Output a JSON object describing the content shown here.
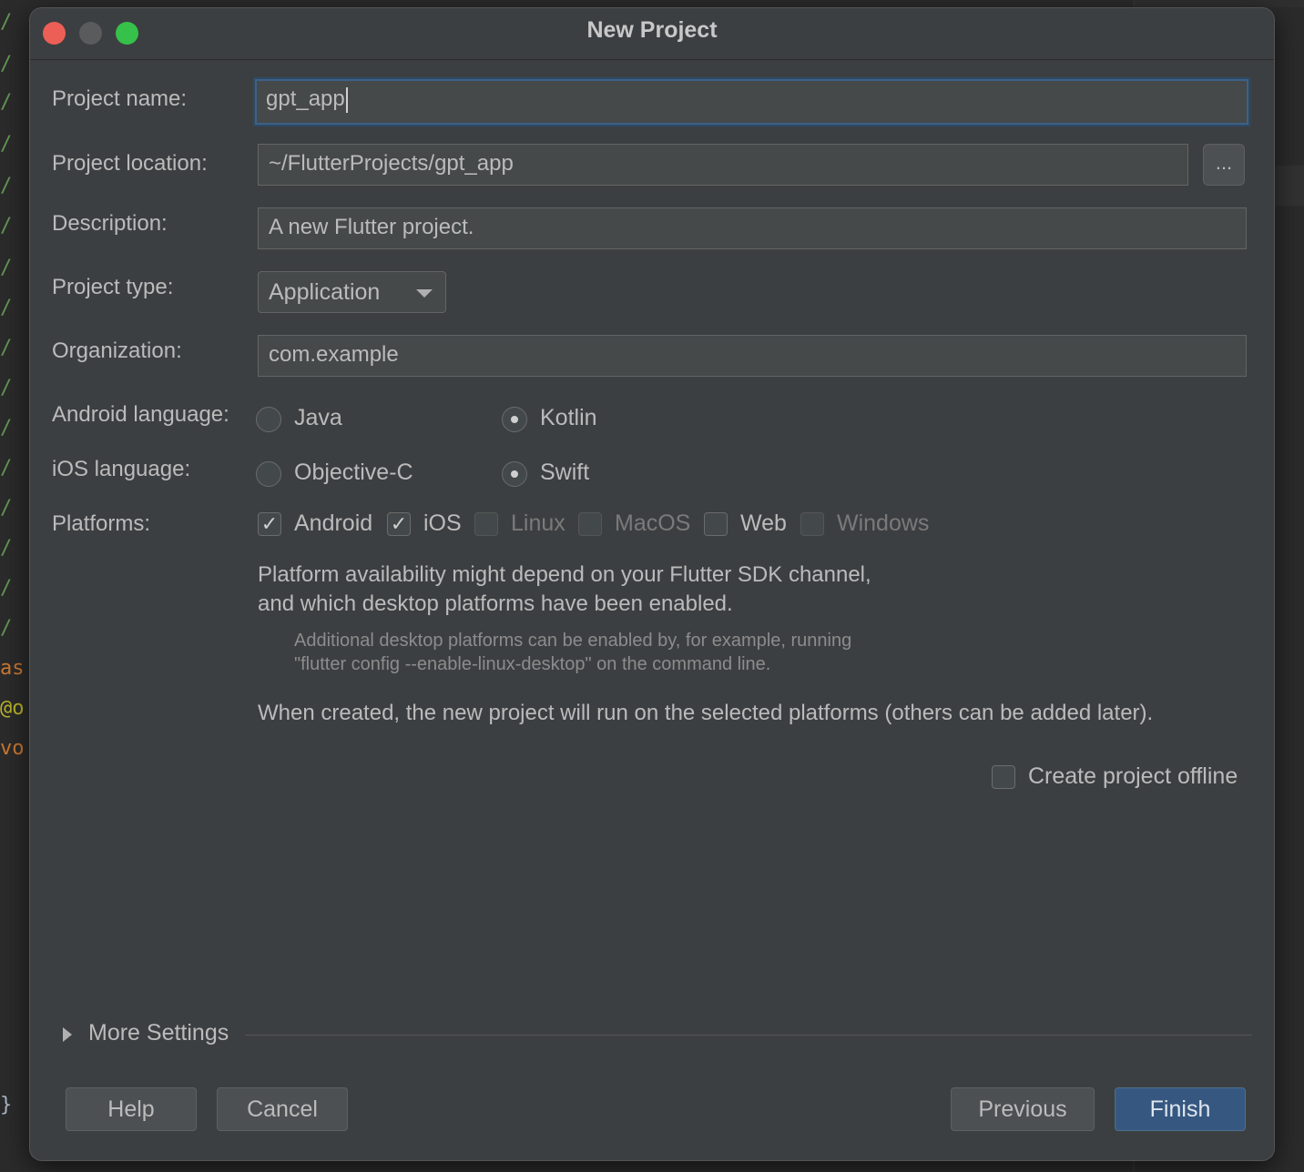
{
  "window": {
    "title": "New Project"
  },
  "form": {
    "project_name_label": "Project name:",
    "project_name_value": "gpt_app",
    "project_location_label": "Project location:",
    "project_location_value": "~/FlutterProjects/gpt_app",
    "browse_label": "...",
    "description_label": "Description:",
    "description_value": "A new Flutter project.",
    "project_type_label": "Project type:",
    "project_type_value": "Application",
    "organization_label": "Organization:",
    "organization_value": "com.example",
    "android_language_label": "Android language:",
    "android_options": [
      {
        "label": "Java",
        "selected": false
      },
      {
        "label": "Kotlin",
        "selected": true
      }
    ],
    "ios_language_label": "iOS language:",
    "ios_options": [
      {
        "label": "Objective-C",
        "selected": false
      },
      {
        "label": "Swift",
        "selected": true
      }
    ],
    "platforms_label": "Platforms:",
    "platforms": [
      {
        "label": "Android",
        "checked": true,
        "enabled": true
      },
      {
        "label": "iOS",
        "checked": true,
        "enabled": true
      },
      {
        "label": "Linux",
        "checked": false,
        "enabled": false
      },
      {
        "label": "MacOS",
        "checked": false,
        "enabled": false
      },
      {
        "label": "Web",
        "checked": false,
        "enabled": true
      },
      {
        "label": "Windows",
        "checked": false,
        "enabled": false
      }
    ],
    "availability_note_line1": "Platform availability might depend on your Flutter SDK channel,",
    "availability_note_line2": "and which desktop platforms have been enabled.",
    "desktop_hint_line1": "Additional desktop platforms can be enabled by, for example, running",
    "desktop_hint_line2": "\"flutter config --enable-linux-desktop\" on the command line.",
    "created_note": "When created, the new project will run on the selected platforms (others can be added later).",
    "offline_label": "Create project offline",
    "offline_checked": false
  },
  "more_settings_label": "More Settings",
  "buttons": {
    "help": "Help",
    "cancel": "Cancel",
    "previous": "Previous",
    "finish": "Finish"
  },
  "colors": {
    "dialog_bg": "#3c3f41",
    "field_bg": "#45494a",
    "primary_button": "#365880",
    "focus_border": "#3d6185"
  }
}
